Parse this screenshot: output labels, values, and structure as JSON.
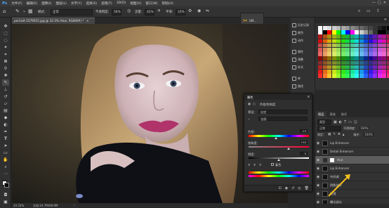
{
  "menu": [
    "文件(F)",
    "编辑(E)",
    "图像(I)",
    "图层(L)",
    "文字(Y)",
    "选择(S)",
    "滤镜(T)",
    "3D(D)",
    "视图(V)",
    "窗口(W)",
    "帮助(H)"
  ],
  "options": {
    "mode_label": "模式：",
    "mode_value": "正常",
    "opacity_label": "不透明度：",
    "opacity_value": "56%",
    "flow_label": "流量：",
    "flow_value": "42%",
    "smooth_label": "平滑：",
    "smooth_value": "10%",
    "notif_label": "GM..."
  },
  "document": {
    "tab_title": "portrait-1579015.jpg @ 33.3% (Hue, RGB/8#) *",
    "zoom": "33.33%",
    "doc_info": "文档:24.7M/48.9M"
  },
  "right_strip": [
    {
      "icon": "history-icon",
      "label": "历史记录"
    },
    {
      "icon": "color-icon",
      "label": "颜色"
    },
    {
      "icon": "actions-icon",
      "label": "动作"
    },
    {
      "icon": "properties-icon",
      "label": "属性"
    },
    {
      "icon": "adjustments-icon",
      "label": "调整"
    },
    {
      "icon": "styles-icon",
      "label": "样式"
    },
    {
      "icon": "layers-icon",
      "label": "库"
    },
    {
      "icon": "paths-icon",
      "label": "路径"
    }
  ],
  "properties": {
    "tab": "属性",
    "title": "色相/饱和度",
    "preset_label": "预设：",
    "preset_value": "自定",
    "channel_value": "全图",
    "hue_label": "色相：",
    "hue_value": "-13",
    "hue_level": 0.45,
    "sat_label": "饱和度：",
    "sat_value": "+33",
    "sat_level": 0.66,
    "light_label": "明度：",
    "light_value": "0",
    "light_level": 0.5,
    "colorize_label": "着色"
  },
  "layers_panel": {
    "tabs": [
      "图层",
      "通道",
      "路径"
    ],
    "kind": "类型",
    "blend": "正常",
    "opacity_label": "不透明度：",
    "opacity_value": "100%",
    "lock_label": "锁定：",
    "fill_label": "填充：",
    "fill_value": "100%",
    "rows": [
      {
        "name": "Lip Enhancer",
        "selected": false,
        "mask": false
      },
      {
        "name": "Detail Enhancer",
        "selected": false,
        "mask": false
      },
      {
        "name": "Hue",
        "selected": true,
        "mask": true
      },
      {
        "name": "Lip Enhancer",
        "selected": false,
        "mask": false
      },
      {
        "name": "中间调",
        "selected": false,
        "mask": false
      },
      {
        "name": "阴影部分",
        "selected": false,
        "mask": false
      },
      {
        "name": "纹理",
        "selected": false,
        "mask": false
      },
      {
        "name": "曝光部分",
        "selected": false,
        "mask": false
      }
    ]
  },
  "colors": {
    "accent": "#2d7fd0",
    "selected_row": "#5d5d5d",
    "bg": "#282828",
    "panel": "#323232"
  }
}
